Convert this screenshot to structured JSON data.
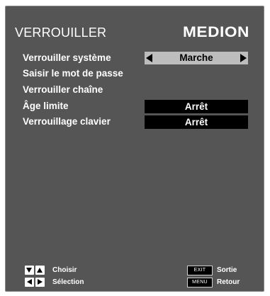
{
  "header": {
    "title": "VERROUILLER",
    "brand": "MEDION"
  },
  "menu": {
    "lock_system": {
      "label": "Verrouiller système",
      "value": "Marche"
    },
    "enter_password": {
      "label": "Saisir le mot de passe"
    },
    "lock_channel": {
      "label": "Verrouiller chaîne"
    },
    "age_limit": {
      "label": "Âge limite",
      "value": "Arrêt"
    },
    "key_lock": {
      "label": "Verrouillage clavier",
      "value": "Arrêt"
    }
  },
  "footer": {
    "choose_label": "Choisir",
    "select_label": "Sélection",
    "exit_key": "EXIT",
    "exit_label": "Sortie",
    "menu_key": "MENU",
    "back_label": "Retour"
  },
  "colors": {
    "panel_bg": "#555555",
    "selector_bg": "#bdbdbd",
    "value_box_bg": "#000000",
    "text": "#ffffff"
  },
  "icons": [
    "arrow-down-icon",
    "arrow-up-icon",
    "arrow-left-icon",
    "arrow-right-icon"
  ]
}
